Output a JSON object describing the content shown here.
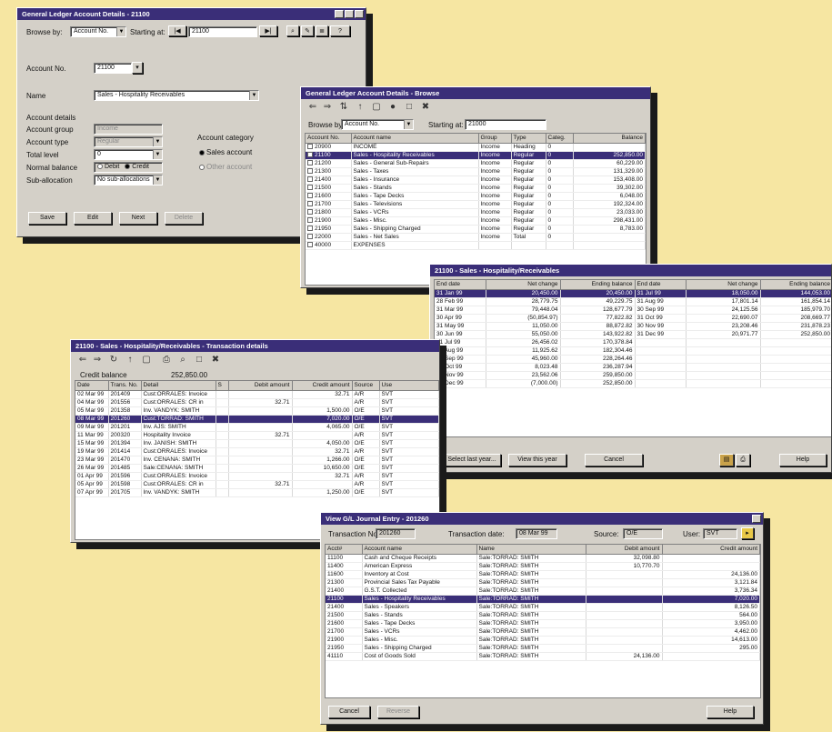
{
  "w1": {
    "title": "General Ledger Account Details - 21100",
    "browse_by_label": "Browse by:",
    "browse_by_value": "Account No.",
    "starting_at_label": "Starting at:",
    "starting_at_value": "21100",
    "account_no_label": "Account No.",
    "account_no_value": "21100",
    "name_label": "Name",
    "name_value": "Sales - Hospitality Receivables",
    "account_details_label": "Account details",
    "account_group_label": "Account group",
    "account_group_value": "Income",
    "account_type_label": "Account type",
    "account_type_value": "Regular",
    "total_level_label": "Total level",
    "total_level_value": "0",
    "normal_balance_label": "Normal balance",
    "debit_label": "Debit",
    "credit_label": "Credit",
    "sub_ledger_label": "Sub-allocation",
    "sub_ledger_value": "No sub-allocations",
    "account_category_label": "Account category",
    "sales_account_label": "Sales account",
    "other_label": "Other account",
    "buttons": [
      "Save",
      "Edit",
      "Next",
      "Delete"
    ]
  },
  "w2": {
    "title": "General Ledger Account Details - Browse",
    "browse_by_label": "Browse by:",
    "browse_by_value": "Account No.",
    "starting_at_label": "Starting at:",
    "starting_at_value": "21000",
    "columns": [
      "Account No.",
      "Account name",
      "Group",
      "Type",
      "Categ.",
      "Balance"
    ],
    "rows": [
      [
        "20900",
        "INCOME",
        "Income",
        "Heading",
        "0",
        ""
      ],
      [
        "21100",
        "Sales - Hospitality Receivables",
        "Income",
        "Regular",
        "0",
        "252,850.00"
      ],
      [
        "21200",
        "Sales - General Sub-Repairs",
        "Income",
        "Regular",
        "0",
        "60,229.00"
      ],
      [
        "21300",
        "Sales - Taxes",
        "Income",
        "Regular",
        "0",
        "131,329.00"
      ],
      [
        "21400",
        "Sales - Insurance",
        "Income",
        "Regular",
        "0",
        "153,408.00"
      ],
      [
        "21500",
        "Sales - Stands",
        "Income",
        "Regular",
        "0",
        "39,302.00"
      ],
      [
        "21600",
        "Sales - Tape Decks",
        "Income",
        "Regular",
        "0",
        "6,048.00"
      ],
      [
        "21700",
        "Sales - Televisions",
        "Income",
        "Regular",
        "0",
        "192,324.00"
      ],
      [
        "21800",
        "Sales - VCRs",
        "Income",
        "Regular",
        "0",
        "23,033.00"
      ],
      [
        "21900",
        "Sales - Misc.",
        "Income",
        "Regular",
        "0",
        "298,431.00"
      ],
      [
        "21950",
        "Sales - Shipping Charged",
        "Income",
        "Regular",
        "0",
        "8,783.00"
      ],
      [
        "22000",
        "Sales - Net Sales",
        "Income",
        "Total",
        "0",
        ""
      ],
      [
        "40000",
        "EXPENSES",
        "",
        "",
        "",
        ""
      ]
    ]
  },
  "w3": {
    "title": "21100 - Sales - Hospitality/Receivables",
    "columns": [
      "End date",
      "Net change",
      "Ending balance",
      "End date",
      "Net change",
      "Ending balance"
    ],
    "rows": [
      [
        "31 Jan 99",
        "20,450.00",
        "20,450.00",
        "31 Jul 99",
        "18,050.00",
        "144,053.00"
      ],
      [
        "28 Feb 99",
        "28,779.75",
        "49,229.75",
        "31 Aug 99",
        "17,801.14",
        "161,854.14"
      ],
      [
        "31 Mar 99",
        "79,448.04",
        "128,677.79",
        "30 Sep 99",
        "24,125.56",
        "185,979.70"
      ],
      [
        "30 Apr 99",
        "(50,854.97)",
        "77,822.82",
        "31 Oct 99",
        "22,690.07",
        "208,669.77"
      ],
      [
        "31 May 99",
        "11,050.00",
        "88,872.82",
        "30 Nov 99",
        "23,208.46",
        "231,878.23"
      ],
      [
        "30 Jun 99",
        "55,050.00",
        "143,922.82",
        "31 Dec 99",
        "20,971.77",
        "252,850.00"
      ],
      [
        "31 Jul 99",
        "26,456.02",
        "170,378.84",
        "",
        "",
        ""
      ],
      [
        "31 Aug 99",
        "11,925.62",
        "182,304.46",
        "",
        "",
        ""
      ],
      [
        "30 Sep 99",
        "45,960.00",
        "228,264.46",
        "",
        "",
        ""
      ],
      [
        "31 Oct 99",
        "8,023.48",
        "236,287.94",
        "",
        "",
        ""
      ],
      [
        "30 Nov 99",
        "23,562.06",
        "259,850.00",
        "",
        "",
        ""
      ],
      [
        "31 Dec 99",
        "(7,000.00)",
        "252,850.00",
        "",
        "",
        ""
      ]
    ],
    "buttons": [
      "Select last year...",
      "View this year",
      "Cancel",
      "Help"
    ]
  },
  "w4": {
    "title": "21100 - Sales - Hospitality/Receivables - Transaction details",
    "credit_balance_label": "Credit balance",
    "credit_balance_value": "252,850.00",
    "columns": [
      "Date",
      "Trans. No.",
      "Detail",
      "S",
      "Debit amount",
      "Credit amount",
      "Source",
      "Use"
    ],
    "rows": [
      [
        "02 Mar 99",
        "201409",
        "Cust:ORRALES: Invoice",
        "",
        "",
        "32.71",
        "A/R",
        "SVT"
      ],
      [
        "04 Mar 99",
        "201556",
        "Cust:ORRALES: CR in",
        "",
        "32.71",
        "",
        "A/R",
        "SVT"
      ],
      [
        "05 Mar 99",
        "201358",
        "Inv. VANDYK: SMITH",
        "",
        "",
        "1,500.00",
        "O/E",
        "SVT"
      ],
      [
        "08 Mar 99",
        "201260",
        "Cust:TORRAD: SMITH",
        "",
        "",
        "7,020.00",
        "O/E",
        "SVT"
      ],
      [
        "09 Mar 99",
        "201201",
        "Inv. AJS: SMITH",
        "",
        "",
        "4,065.00",
        "O/E",
        "SVT"
      ],
      [
        "11 Mar 99",
        "200320",
        "Hospitality Invoice",
        "",
        "32.71",
        "",
        "A/R",
        "SVT"
      ],
      [
        "15 Mar 99",
        "201394",
        "Inv. JANISH: SMITH",
        "",
        "",
        "4,050.00",
        "O/E",
        "SVT"
      ],
      [
        "19 Mar 99",
        "201414",
        "Cust:ORRALES: Invoice",
        "",
        "",
        "32.71",
        "A/R",
        "SVT"
      ],
      [
        "23 Mar 99",
        "201470",
        "Inv. CENANA: SMITH",
        "",
        "",
        "1,266.00",
        "O/E",
        "SVT"
      ],
      [
        "26 Mar 99",
        "201485",
        "Sale:CENANA: SMITH",
        "",
        "",
        "10,650.00",
        "O/E",
        "SVT"
      ],
      [
        "01 Apr 99",
        "201596",
        "Cust:ORRALES: Invoice",
        "",
        "",
        "32.71",
        "A/R",
        "SVT"
      ],
      [
        "05 Apr 99",
        "201598",
        "Cust:ORRALES: CR in",
        "",
        "32.71",
        "",
        "A/R",
        "SVT"
      ],
      [
        "07 Apr 99",
        "201705",
        "Inv. VANDYK: SMITH",
        "",
        "",
        "1,250.00",
        "O/E",
        "SVT"
      ]
    ]
  },
  "w5": {
    "title": "View G/L Journal Entry - 201260",
    "trans_no_label": "Transaction No.",
    "trans_no_value": "201260",
    "trans_date_label": "Transaction date:",
    "trans_date_value": "08 Mar 99",
    "source_label": "Source:",
    "source_value": "O/E",
    "user_label": "User:",
    "user_value": "SVT",
    "columns": [
      "Acct#",
      "Account name",
      "Name",
      "Debit amount",
      "Credit amount"
    ],
    "rows": [
      [
        "11100",
        "Cash and Cheque Receipts",
        "Sale:TORRAD: SMITH",
        "32,098.80",
        ""
      ],
      [
        "11400",
        "American Express",
        "Sale:TORRAD: SMITH",
        "10,770.70",
        ""
      ],
      [
        "11600",
        "Inventory at Cost",
        "Sale:TORRAD: SMITH",
        "",
        "24,136.00"
      ],
      [
        "21300",
        "Provincial Sales Tax Payable",
        "Sale:TORRAD: SMITH",
        "",
        "3,121.84"
      ],
      [
        "21400",
        "G.S.T. Collected",
        "Sale:TORRAD: SMITH",
        "",
        "3,736.34"
      ],
      [
        "21100",
        "Sales - Hospitality Receivables",
        "Sale:TORRAD: SMITH",
        "",
        "7,020.00"
      ],
      [
        "21400",
        "Sales - Speakers",
        "Sale:TORRAD: SMITH",
        "",
        "8,126.50"
      ],
      [
        "21500",
        "Sales - Stands",
        "Sale:TORRAD: SMITH",
        "",
        "564.00"
      ],
      [
        "21600",
        "Sales - Tape Decks",
        "Sale:TORRAD: SMITH",
        "",
        "3,950.00"
      ],
      [
        "21700",
        "Sales - VCRs",
        "Sale:TORRAD: SMITH",
        "",
        "4,462.00"
      ],
      [
        "21900",
        "Sales - Misc.",
        "Sale:TORRAD: SMITH",
        "",
        "14,613.00"
      ],
      [
        "21950",
        "Sales - Shipping Charged",
        "Sale:TORRAD: SMITH",
        "",
        "295.00"
      ],
      [
        "41110",
        "Cost of Goods Sold",
        "Sale:TORRAD: SMITH",
        "24,136.00",
        ""
      ]
    ],
    "buttons": [
      "Cancel",
      "Reverse",
      "Help"
    ]
  }
}
